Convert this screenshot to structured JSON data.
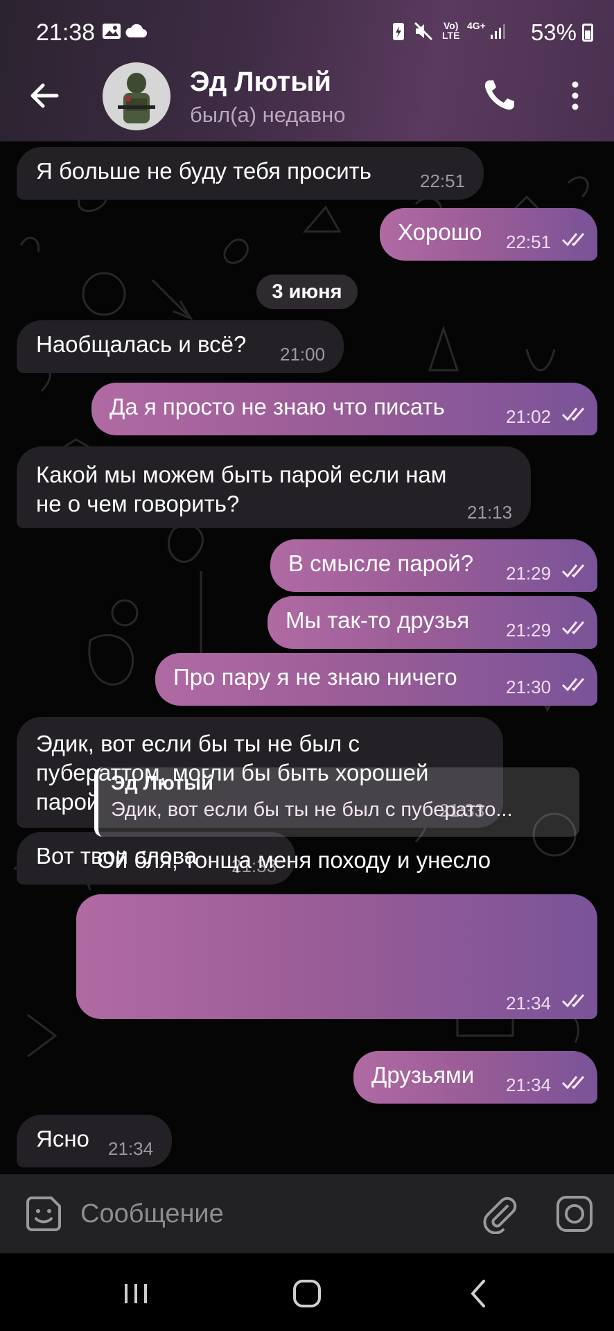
{
  "status_bar": {
    "time": "21:38",
    "battery": "53%",
    "network": "4G+"
  },
  "header": {
    "contact_name": "Эд Лютый",
    "contact_status": "был(а) недавно"
  },
  "date_divider": "3 июня",
  "messages": [
    {
      "dir": "in",
      "text": "Я больше не буду тебя просить",
      "time": "22:51"
    },
    {
      "dir": "out",
      "text": "Хорошо",
      "time": "22:51"
    },
    {
      "dir": "in",
      "text": "Наобщалась и всё?",
      "time": "21:00"
    },
    {
      "dir": "out",
      "text": "Да я просто не знаю что писать",
      "time": "21:02"
    },
    {
      "dir": "in",
      "text_line1": "Какой мы можем быть парой если нам",
      "text_line2": "не о чем говорить?",
      "time": "21:13"
    },
    {
      "dir": "out",
      "text": "В смысле парой?",
      "time": "21:29"
    },
    {
      "dir": "out",
      "text": "Мы так-то друзья",
      "time": "21:29"
    },
    {
      "dir": "out",
      "text": "Про пару я не знаю ничего",
      "time": "21:30"
    },
    {
      "dir": "in",
      "text_line1": "Эдик, вот если бы ты не был с",
      "text_line2": "пубераттом, могли бы быть хорошей",
      "text_line3": "парой",
      "time": "21:33"
    },
    {
      "dir": "in",
      "text": "Вот твои слова",
      "time": "21:33"
    },
    {
      "dir": "out",
      "reply_name": "Эд Лютый",
      "reply_text": "Эдик, вот если бы ты не был с пубератто...",
      "text": "Ой бля, тонща меня походу и унесло",
      "time": "21:34"
    },
    {
      "dir": "out",
      "text": "Друзьями",
      "time": "21:34"
    },
    {
      "dir": "in",
      "text": "Ясно",
      "time": "21:34"
    }
  ],
  "input": {
    "placeholder": "Сообщение",
    "value": ""
  },
  "colors": {
    "header_accent": "#5a3a5e",
    "incoming_bubble": "#232125",
    "outgoing_bubble_start": "#b06aa3",
    "outgoing_bubble_end": "#7a5398",
    "input_bar": "#222124"
  },
  "icons": [
    "back-arrow-icon",
    "phone-icon",
    "more-vert-icon",
    "sticker-icon",
    "paperclip-icon",
    "camera-icon",
    "recents-icon",
    "home-icon",
    "nav-back-icon",
    "double-check-icon"
  ]
}
